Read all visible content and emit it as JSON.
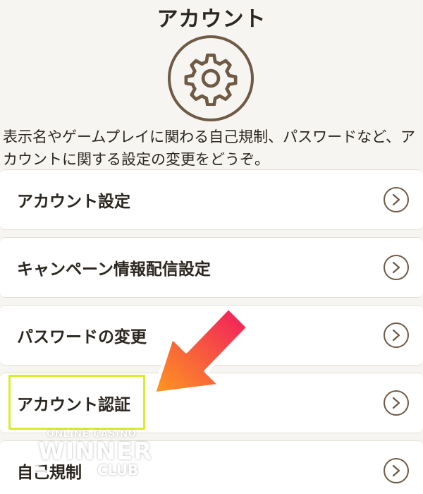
{
  "header": {
    "title": "アカウント",
    "icon": "gear-icon"
  },
  "description": "表示名やゲームプレイに関わる自己規制、パスワードなど、アカウントに関する設定の変更をどうぞ。",
  "menu": {
    "items": [
      {
        "label": "アカウント設定",
        "icon": "chevron-right-icon"
      },
      {
        "label": "キャンペーン情報配信設定",
        "icon": "chevron-right-icon"
      },
      {
        "label": "パスワードの変更",
        "icon": "chevron-right-icon"
      },
      {
        "label": "アカウント認証",
        "icon": "chevron-right-icon",
        "highlighted": true
      },
      {
        "label": "自己規制",
        "icon": "chevron-right-icon"
      }
    ]
  },
  "annotation": {
    "arrow_icon": "pointer-arrow-icon",
    "highlight_color": "#d9ec2f"
  },
  "watermark": {
    "top_text": "ONLINE CASINO",
    "main_text": "WINNER",
    "sub_text": "CLUB"
  },
  "colors": {
    "background": "#f7f5f1",
    "accent_brown": "#6e5a45",
    "arrow_gradient_start": "#ff9a1f",
    "arrow_gradient_end": "#f0185f"
  }
}
